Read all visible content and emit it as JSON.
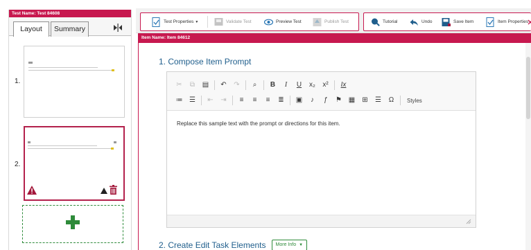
{
  "test_name": "Test Name: Test 84608",
  "left_panel": {
    "tabs": [
      {
        "label": "Layout"
      },
      {
        "label": "Summary"
      }
    ],
    "items": [
      {
        "number": "1."
      },
      {
        "number": "2."
      }
    ]
  },
  "toolbar": {
    "test_properties": "Test Properties",
    "validate_test": "Validate Test",
    "preview_test": "Preview Test",
    "publish_test": "Publish Test",
    "tutorial": "Tutorial",
    "undo": "Undo",
    "save_item": "Save Item",
    "item_properties": "Item Properties"
  },
  "main": {
    "item_name": "Item Name: Item 84612",
    "section1_title": "1. Compose Item Prompt",
    "editor": {
      "styles_label": "Styles",
      "content": "Replace this sample text with the prompt or directions for this item."
    },
    "section2_title": "2. Create Edit Task Elements",
    "more_info_label": "More Info"
  },
  "colors": {
    "accent": "#c7184f",
    "link_blue": "#1f5e8c",
    "add_green": "#2e8b3a"
  }
}
